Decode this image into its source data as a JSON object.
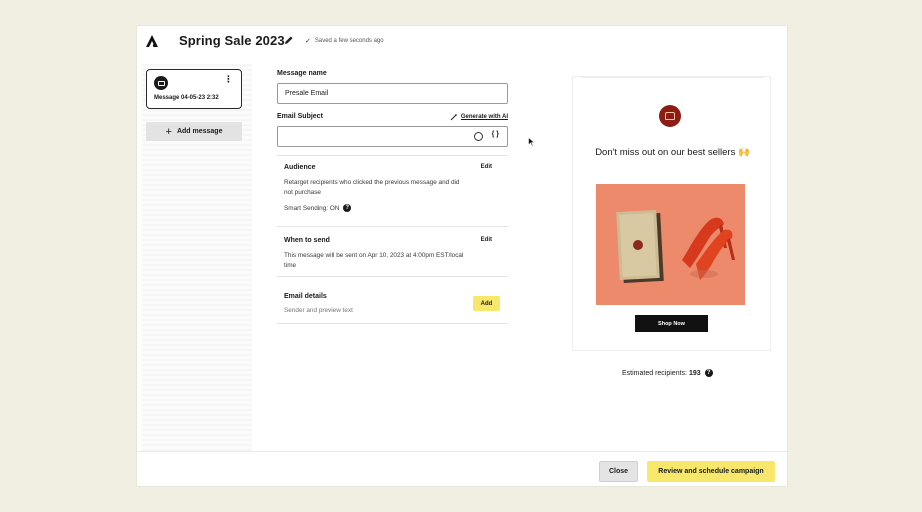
{
  "header": {
    "title": "Spring Sale 2023",
    "saved_status": "Saved a few seconds ago"
  },
  "sidebar": {
    "message_label": "Message 04-05-23 2:32",
    "add_message_label": "Add message"
  },
  "form": {
    "message_name_label": "Message name",
    "message_name_value": "Presale Email",
    "email_subject_label": "Email Subject",
    "email_subject_value": "",
    "generate_ai_label": "Generate with AI",
    "personalization_glyph": "{ }"
  },
  "sections": {
    "audience": {
      "title": "Audience",
      "edit_label": "Edit",
      "description": "Retarget recipients who clicked the previous message and did not purchase",
      "smart_sending": "Smart Sending: ON"
    },
    "when_to_send": {
      "title": "When to send",
      "edit_label": "Edit",
      "description": "This message will be sent on Apr 10, 2023 at 4:00pm EST/local time"
    },
    "email_details": {
      "title": "Email details",
      "add_label": "Add",
      "description": "Sender and preview text"
    }
  },
  "preview": {
    "headline": "Don't miss out on our best sellers 🙌",
    "cta_label": "Shop Now",
    "estimated_label": "Estimated recipients:",
    "estimated_count": "193"
  },
  "footer": {
    "close_label": "Close",
    "review_label": "Review and schedule campaign"
  },
  "colors": {
    "background": "#f1eee2",
    "accent_yellow": "#f7e86b",
    "brand_dark": "#1a1a1a",
    "logo_red": "#8c1d14",
    "product_bg": "#ee8a6c"
  },
  "icons": [
    "logo-icon",
    "pencil-icon",
    "check-icon",
    "email-icon",
    "kebab-icon",
    "plus-icon",
    "magic-wand-icon",
    "emoji-icon",
    "braces-icon",
    "help-icon",
    "brand-logo-icon",
    "cursor-icon"
  ]
}
